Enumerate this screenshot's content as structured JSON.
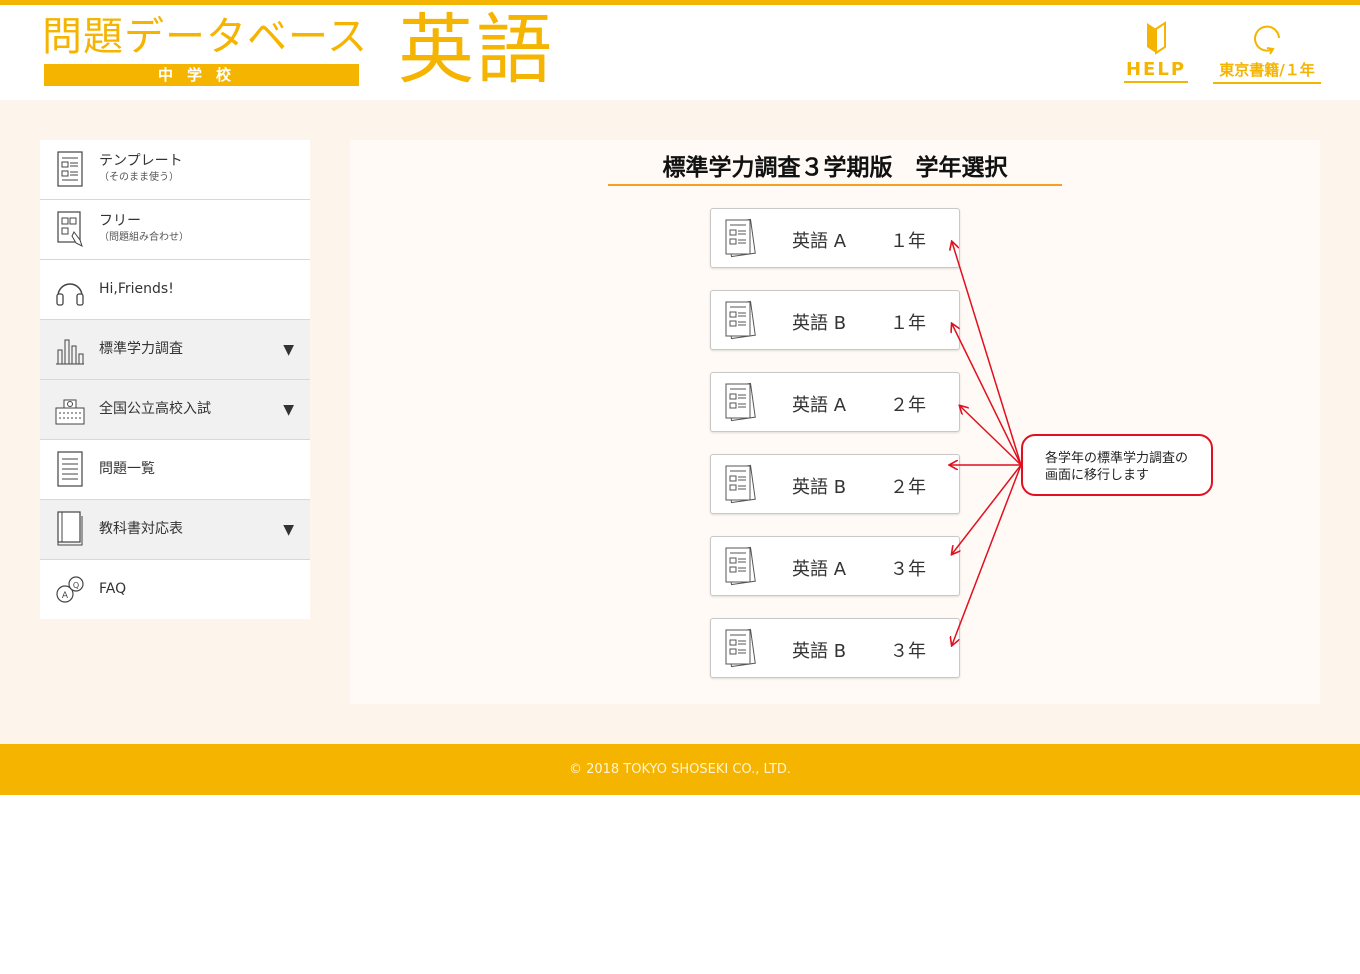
{
  "header": {
    "title": "問題データベース",
    "subtitle": "中学校",
    "subject": "英語",
    "help_label": "HELP",
    "publisher_label": "東京書籍/１年"
  },
  "sidebar": {
    "items": [
      {
        "label": "テンプレート",
        "sub": "（そのまま使う）"
      },
      {
        "label": "フリー",
        "sub": "（問題組み合わせ）"
      },
      {
        "label": "Hi,Friends!"
      },
      {
        "label": "標準学力調査",
        "arrow": "▼"
      },
      {
        "label": "全国公立高校入試",
        "arrow": "▼"
      },
      {
        "label": "問題一覧"
      },
      {
        "label": "教科書対応表",
        "arrow": "▼"
      },
      {
        "label": "FAQ"
      }
    ]
  },
  "main": {
    "title": "標準学力調査３学期版　学年選択",
    "grades": [
      {
        "subject": "英語 A",
        "year": "１年"
      },
      {
        "subject": "英語 B",
        "year": "１年"
      },
      {
        "subject": "英語 A",
        "year": "２年"
      },
      {
        "subject": "英語 B",
        "year": "２年"
      },
      {
        "subject": "英語 A",
        "year": "３年"
      },
      {
        "subject": "英語 B",
        "year": "３年"
      }
    ]
  },
  "callout": {
    "line1": "各学年の標準学力調査の",
    "line2": "画面に移行します"
  },
  "footer": {
    "copyright": "© 2018 TOKYO SHOSEKI CO., LTD."
  },
  "colors": {
    "brand": "#f5b400",
    "background": "#fdf5ec",
    "annotation": "#e01020"
  }
}
